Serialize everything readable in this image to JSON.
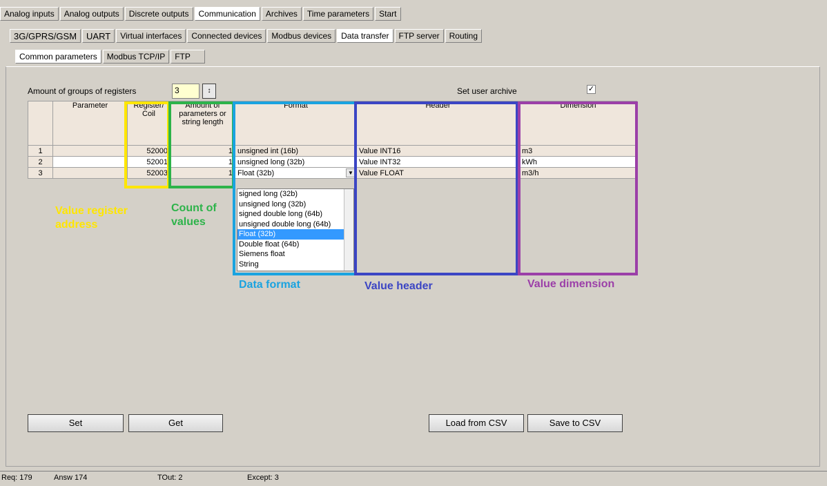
{
  "tabs_main": [
    "Analog inputs",
    "Analog outputs",
    "Discrete outputs",
    "Communication",
    "Archives",
    "Time parameters",
    "Start"
  ],
  "tabs_comm": [
    "3G/GPRS/GSM",
    "UART",
    "Virtual interfaces",
    "Connected devices",
    "Modbus devices",
    "Data transfer",
    "FTP server",
    "Routing"
  ],
  "tabs_data": [
    "Common parameters",
    "Modbus TCP/IP",
    "FTP"
  ],
  "groups_label": "Amount of groups of registers",
  "groups_value": "3",
  "user_archive_label": "Set user archive",
  "user_archive_checked": "☑",
  "headers": {
    "parameter": "Parameter",
    "register": "Register/ Coil",
    "amount": "Amount of parameters or string length",
    "format": "Format",
    "header": "Header",
    "dimension": "Dimension"
  },
  "rows": [
    {
      "n": "1",
      "param": "",
      "reg": "52000",
      "amount": "1",
      "format": "unsigned int (16b)",
      "header": "Value INT16",
      "dim": "m3"
    },
    {
      "n": "2",
      "param": "",
      "reg": "52001",
      "amount": "1",
      "format": "unsigned long (32b)",
      "header": "Value INT32",
      "dim": "kWh"
    },
    {
      "n": "3",
      "param": "",
      "reg": "52003",
      "amount": "1",
      "format": "Float (32b)",
      "header": "Value FLOAT",
      "dim": "m3/h"
    }
  ],
  "dropdown_options": [
    "signed long (32b)",
    "unsigned long (32b)",
    "signed double long (64b)",
    "unsigned double long (64b)",
    "Float (32b)",
    "Double float (64b)",
    "Siemens float",
    "String"
  ],
  "annotations": {
    "register": "Value register address",
    "count": "Count of values",
    "format": "Data format",
    "header": "Value header",
    "dimension": "Value dimension"
  },
  "colors": {
    "yellow": "#ffe600",
    "green": "#2db34a",
    "cyan": "#1aa3e0",
    "blue": "#3b45c4",
    "purple": "#9b3fa8"
  },
  "buttons": {
    "set": "Set",
    "get": "Get",
    "load": "Load from CSV",
    "save": "Save to CSV"
  },
  "status": {
    "req": "Req: 179",
    "answ": "Answ   174",
    "tout": "TOut: 2",
    "except": "Except:  3"
  }
}
